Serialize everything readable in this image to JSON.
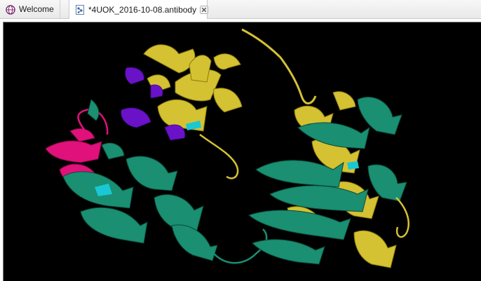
{
  "tabs": [
    {
      "label": "Welcome",
      "icon": "globe-icon",
      "active": false
    },
    {
      "label": "*4UOK_2016-10-08.antibody",
      "icon": "molecule-document-icon",
      "active": true,
      "closable": true
    }
  ],
  "viewer": {
    "background": "#000000",
    "chain_colors": {
      "heavy_chain_yellow": "#d4c232",
      "light_chain_teal": "#1a8f72",
      "antigen_magenta": "#e0117a",
      "cdr_purple": "#6a12c8",
      "highlight_cyan": "#19c8d4"
    }
  }
}
